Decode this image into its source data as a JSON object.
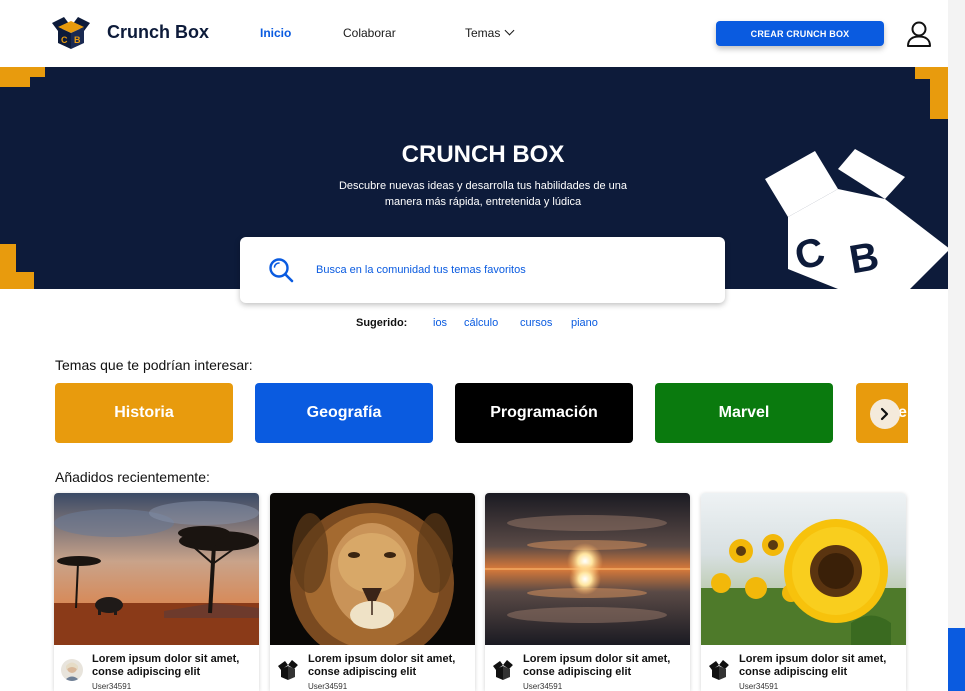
{
  "header": {
    "brand": "Crunch Box",
    "nav": [
      {
        "label": "Inicio",
        "active": true
      },
      {
        "label": "Colaborar",
        "active": false
      },
      {
        "label": "Temas",
        "active": false
      }
    ],
    "cta_label": "CREAR CRUNCH BOX"
  },
  "hero": {
    "title": "CRUNCH BOX",
    "subtitle_line1": "Descubre nuevas ideas y desarrolla tus habilidades de una",
    "subtitle_line2": "manera más rápida, entretenida y lúdica"
  },
  "search": {
    "placeholder": "Busca en la comunidad tus temas favoritos"
  },
  "suggested": {
    "label": "Sugerido:",
    "items": [
      "ios",
      "cálculo",
      "cursos",
      "piano"
    ]
  },
  "topics": {
    "title": "Temas que te podrían interesar:",
    "items": [
      {
        "label": "Historia",
        "color": "#e89b0d"
      },
      {
        "label": "Geografía",
        "color": "#0a5be0"
      },
      {
        "label": "Programación",
        "color": "#000000"
      },
      {
        "label": "Marvel",
        "color": "#0a7a0e"
      },
      {
        "label": "e",
        "color": "#e89b0d"
      }
    ]
  },
  "recent": {
    "title": "Añadidos recientemente:",
    "cards": [
      {
        "title": "Lorem ipsum dolor sit amet, conse adipiscing elit",
        "user": "User34591",
        "image": "savanna-elephant-photo"
      },
      {
        "title": "Lorem ipsum dolor sit amet, conse adipiscing elit",
        "user": "User34591",
        "image": "lion-photo"
      },
      {
        "title": "Lorem ipsum dolor sit amet, conse adipiscing elit",
        "user": "User34591",
        "image": "sunset-reflection-photo"
      },
      {
        "title": "Lorem ipsum dolor sit amet, conse adipiscing elit",
        "user": "User34591",
        "image": "sunflower-photo"
      }
    ]
  },
  "colors": {
    "primary": "#0a5be0",
    "navy": "#0d1b3a",
    "accent": "#e89b0d"
  }
}
